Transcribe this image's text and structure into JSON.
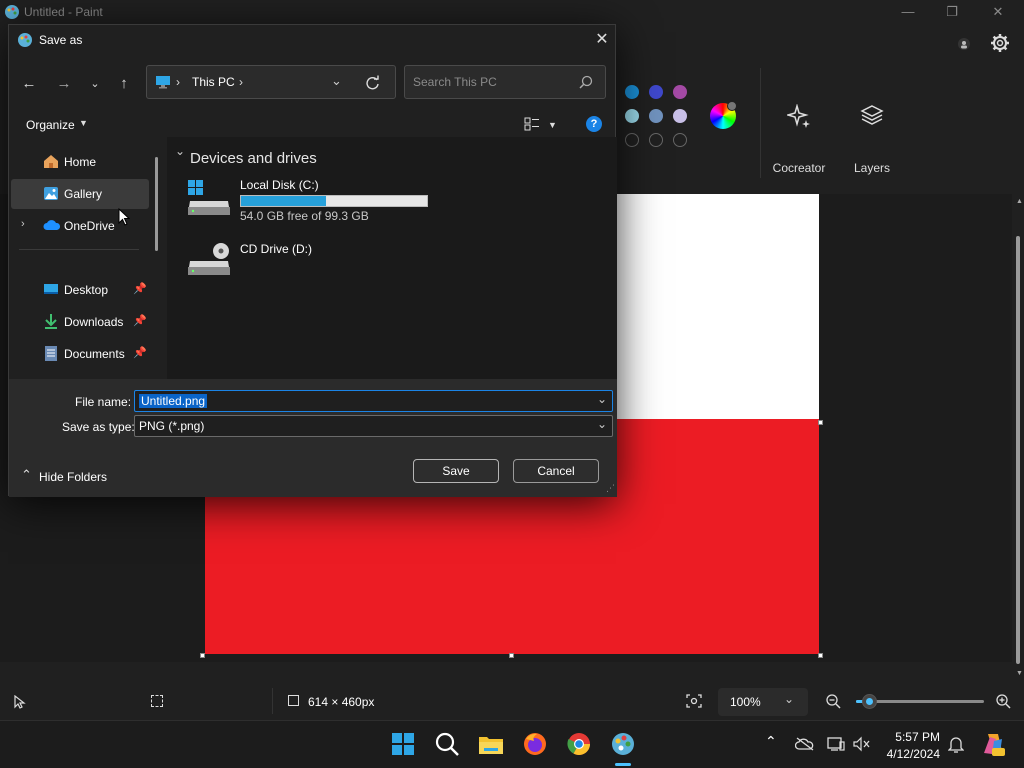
{
  "paint": {
    "title": "Untitled - Paint",
    "ribbon": {
      "cocreator_label": "Cocreator",
      "layers_label": "Layers"
    },
    "canvas": {
      "top_color": "#ffffff",
      "bottom_color": "#ec1c24"
    },
    "status": {
      "canvas_size": "614 × 460px",
      "zoom": "100%",
      "zoom_slider_level": 0.1
    }
  },
  "dialog": {
    "title": "Save as",
    "address": {
      "crumb": "This PC"
    },
    "search": {
      "placeholder": "Search This PC"
    },
    "organize_label": "Organize",
    "nav_pane": {
      "items": [
        {
          "label": "Home"
        },
        {
          "label": "Gallery"
        },
        {
          "label": "OneDrive"
        },
        {
          "label": "Desktop"
        },
        {
          "label": "Downloads"
        },
        {
          "label": "Documents"
        }
      ]
    },
    "content": {
      "group_title": "Devices and drives",
      "drives": [
        {
          "name": "Local Disk (C:)",
          "free_text": "54.0 GB free of 99.3 GB",
          "used_fraction": 0.456
        },
        {
          "name": "CD Drive (D:)"
        }
      ]
    },
    "file_name_label": "File name:",
    "file_name_value": "Untitled.png",
    "save_type_label": "Save as type:",
    "save_type_value": "PNG (*.png)",
    "hide_folders_label": "Hide Folders",
    "save_label": "Save",
    "cancel_label": "Cancel"
  },
  "taskbar": {
    "time": "5:57 PM",
    "date": "4/12/2024"
  },
  "colors": {
    "accent": "#0078d4",
    "drive_bar": "#26a0da"
  }
}
